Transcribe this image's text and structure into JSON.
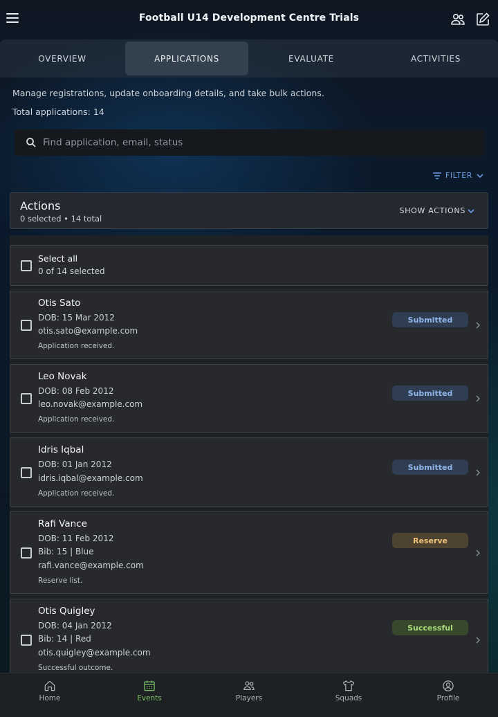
{
  "header": {
    "title": "Football U14 Development Centre Trials",
    "menu_icon": "hamburger-icon",
    "right_icons": [
      "people-icon",
      "edit-icon"
    ]
  },
  "tabs": [
    {
      "label": "OVERVIEW",
      "active": false
    },
    {
      "label": "APPLICATIONS",
      "active": true
    },
    {
      "label": "EVALUATE",
      "active": false
    },
    {
      "label": "ACTIVITIES",
      "active": false
    }
  ],
  "intro": {
    "description": "Manage registrations, update onboarding details, and take bulk actions.",
    "total": "Total applications: 14"
  },
  "search": {
    "placeholder": "Find application, email, status",
    "value": ""
  },
  "filter_label": "FILTER",
  "actions": {
    "title": "Actions",
    "subtitle": "0 selected • 14 total",
    "show_label": "SHOW ACTIONS"
  },
  "select_all": {
    "label": "Select all",
    "count": "0 of 14 selected"
  },
  "applications": [
    {
      "name": "Otis Sato",
      "dob": "DOB: 15 Mar 2012",
      "bib": "",
      "email": "otis.sato@example.com",
      "note": "Application received.",
      "status": "Submitted"
    },
    {
      "name": "Leo Novak",
      "dob": "DOB: 08 Feb 2012",
      "bib": "",
      "email": "leo.novak@example.com",
      "note": "Application received.",
      "status": "Submitted"
    },
    {
      "name": "Idris Iqbal",
      "dob": "DOB: 01 Jan 2012",
      "bib": "",
      "email": "idris.iqbal@example.com",
      "note": "Application received.",
      "status": "Submitted"
    },
    {
      "name": "Rafi Vance",
      "dob": "DOB: 11 Feb 2012",
      "bib": "Bib: 15 | Blue",
      "email": "rafi.vance@example.com",
      "note": "Reserve list.",
      "status": "Reserve"
    },
    {
      "name": "Otis Quigley",
      "dob": "DOB: 04 Jan 2012",
      "bib": "Bib: 14 | Red",
      "email": "otis.quigley@example.com",
      "note": "Successful outcome.",
      "status": "Successful"
    }
  ],
  "status_colors": {
    "Submitted": "#8fb5ea",
    "Reserve": "#f0c47c",
    "Successful": "#a9d97a"
  },
  "bottom_nav": [
    {
      "label": "Home",
      "icon": "home-icon",
      "active": false
    },
    {
      "label": "Events",
      "icon": "calendar-icon",
      "active": true
    },
    {
      "label": "Players",
      "icon": "players-icon",
      "active": false
    },
    {
      "label": "Squads",
      "icon": "shirt-icon",
      "active": false
    },
    {
      "label": "Profile",
      "icon": "profile-icon",
      "active": false
    }
  ],
  "accent_color": "#6a9fe8",
  "active_nav_color": "#7fbf6a"
}
